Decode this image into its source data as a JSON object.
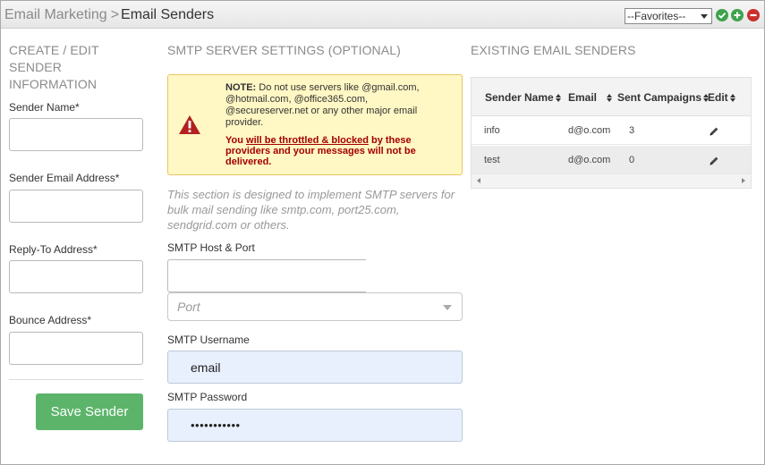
{
  "breadcrumb": {
    "parent": "Email Marketing",
    "separator": ">",
    "current": "Email Senders"
  },
  "favorites": {
    "selected": "--Favorites--"
  },
  "header_icons": [
    "check-icon",
    "plus-icon",
    "minus-icon"
  ],
  "colors": {
    "save_button": "#5cb46a",
    "check": "#3fa34d",
    "plus": "#3fa34d",
    "minus": "#c9302c",
    "note_bg": "#fff7c4",
    "note_red": "#a40000",
    "autofill_bg": "#e8f0fe"
  },
  "left": {
    "heading": "CREATE / EDIT SENDER INFORMATION",
    "sender_name_label": "Sender Name*",
    "sender_name_value": "",
    "sender_email_label": "Sender Email Address*",
    "sender_email_value": "",
    "reply_to_label": "Reply-To Address*",
    "reply_to_value": "",
    "bounce_label": "Bounce Address*",
    "bounce_value": "",
    "save_label": "Save Sender"
  },
  "smtp": {
    "heading": "SMTP SERVER SETTINGS (OPTIONAL)",
    "note_bold": "NOTE:",
    "note_text": " Do not use servers like @gmail.com, @hotmail.com, @office365.com, @secureserver.net or any other major email provider.",
    "warn_prefix": "You ",
    "warn_underline": "will be throttled & blocked",
    "warn_suffix": " by these providers and your messages will not be delivered.",
    "description": "This section is designed to implement SMTP servers for bulk mail sending like smtp.com, port25.com, sendgrid.com or others.",
    "host_label": "SMTP Host & Port",
    "host_value": "",
    "port_placeholder": "Port",
    "username_label": "SMTP Username",
    "username_value": "email",
    "password_label": "SMTP Password",
    "password_value": "•••••••••••"
  },
  "existing": {
    "heading": "EXISTING EMAIL SENDERS",
    "columns": [
      "Sender Name",
      "Email",
      "Sent Campaigns",
      "Edit"
    ],
    "rows": [
      {
        "sender_name": "info",
        "email": "d@o.com",
        "sent_campaigns": "3",
        "edit_icon": "pencil-icon"
      },
      {
        "sender_name": "test",
        "email": "d@o.com",
        "sent_campaigns": "0",
        "edit_icon": "pencil-icon"
      }
    ]
  }
}
